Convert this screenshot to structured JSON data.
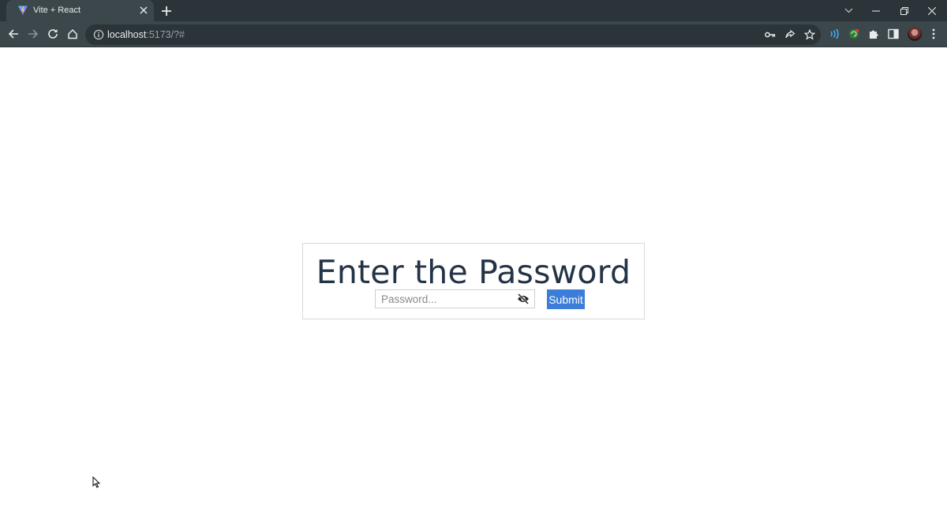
{
  "browser": {
    "tab": {
      "title": "Vite + React"
    },
    "address": {
      "host": "localhost",
      "rest": ":5173/?#"
    }
  },
  "page": {
    "title": "Enter the Password",
    "password": {
      "placeholder": "Password...",
      "value": ""
    },
    "submit_label": "Submit"
  },
  "icons": {
    "favicon": "vite-logo-icon",
    "eye_toggle": "eye-slash-icon"
  },
  "colors": {
    "title": "#243447",
    "submit_bg": "#3b7dd8",
    "chrome_dark": "#2b3438",
    "chrome_toolbar": "#3c474c"
  }
}
